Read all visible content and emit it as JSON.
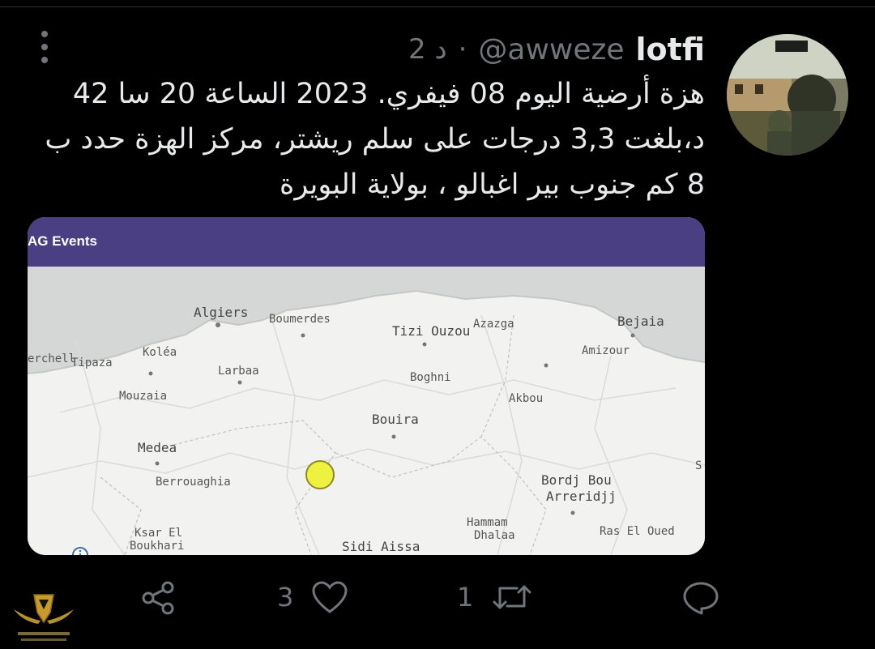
{
  "tweet": {
    "author_name": "lotfi",
    "handle": "@awweze",
    "time_ago": "2 د",
    "separator": "·",
    "text_lines": [
      "هزة أرضية اليوم 08 فيفري. 2023 الساعة 20 سا 42",
      "د،بلغت 3,3 درجات على سلم ريشتر،  مركز الهزة حدد ب",
      "8 كم جنوب  بير اغبالو ، بولاية البويرة"
    ]
  },
  "media": {
    "app_title": "AG Events",
    "map_labels": {
      "algiers": "Algiers",
      "boumerdes": "Boumerdes",
      "tizi_ouzou": "Tizi Ouzou",
      "azazga": "Azazga",
      "bejaia": "Bejaia",
      "cherchell": "erchell",
      "tipaza": "Tipaza",
      "kolea": "Koléa",
      "larbaa": "Larbaa",
      "boghni": "Boghni",
      "amizour": "Amizour",
      "mouzaia": "Mouzaia",
      "akbou": "Akbou",
      "bouira": "Bouira",
      "medea": "Medea",
      "berrouaghia": "Berrouaghia",
      "bordj_line1": "Bordj Bou",
      "bordj_line2": "Arreridjj",
      "setif_partial": "S",
      "hammam_line1": "Hammam",
      "hammam_line2": "Dhalaa",
      "ras_el_oued": "Ras El Oued",
      "ksar_line1": "Ksar El",
      "ksar_line2": "Boukhari",
      "sidi_aissa": "Sidi Aissa"
    }
  },
  "actions": {
    "reply_count": "",
    "retweet_count": "1",
    "like_count": "3"
  },
  "colors": {
    "background": "#000000",
    "secondary_text": "#71767b",
    "app_bar": "#4b3f83",
    "marker": "#eef23e"
  }
}
